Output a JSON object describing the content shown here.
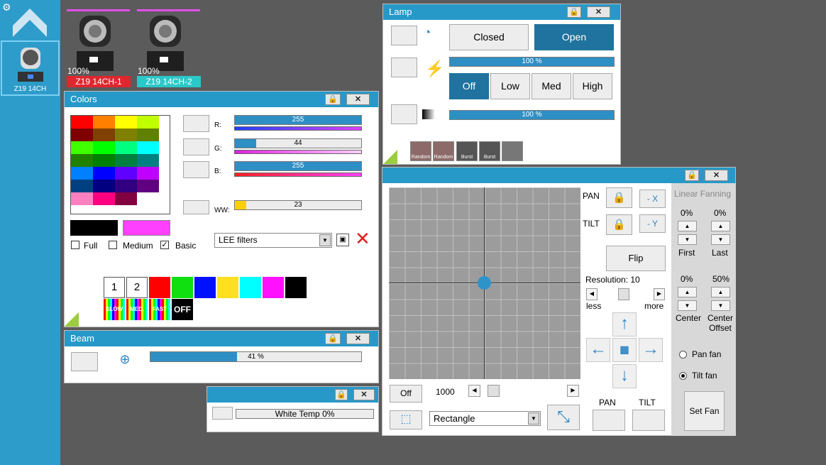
{
  "sidebar": {
    "settings_icon": "gear-icon",
    "logo_icon": "chevron-up-icon",
    "fixture_label": "Z19 14CH"
  },
  "fixtures": [
    {
      "percent": "100%",
      "name": "Z19 14CH-1",
      "color": "#e0262e",
      "bar": "#e050e8"
    },
    {
      "percent": "100%",
      "name": "Z19 14CH-2",
      "color": "#2bc8c8",
      "bar": "#e050e8"
    }
  ],
  "colors": {
    "title": "Colors",
    "lock": "lock-icon",
    "close": "✕",
    "grid": [
      [
        "#ff0000",
        "#ff8000",
        "#ffff00",
        "#c0ff00"
      ],
      [
        "#800000",
        "#804000",
        "#808000",
        "#608000"
      ],
      [
        "#40ff00",
        "#00ff00",
        "#00ff80",
        "#00ffff"
      ],
      [
        "#208000",
        "#008000",
        "#008040",
        "#008080"
      ],
      [
        "#0080ff",
        "#0000ff",
        "#6000ff",
        "#c000ff"
      ],
      [
        "#004080",
        "#000080",
        "#300080",
        "#600080"
      ],
      [
        "#ff80c0",
        "#ff0080",
        "#800040",
        "#ffffff"
      ]
    ],
    "channels": [
      {
        "label": "R:",
        "value": "255",
        "fill": 1.0,
        "grad": "linear-gradient(90deg,#2040ff,#e040ff)"
      },
      {
        "label": "G:",
        "value": "44",
        "fill": 0.17,
        "grad": "linear-gradient(90deg,#e020e0,#ffd0ff)"
      },
      {
        "label": "B:",
        "value": "255",
        "fill": 1.0,
        "grad": "linear-gradient(90deg,#ff2020,#ff40ff)"
      },
      {
        "label": "WW:",
        "value": "23",
        "fill": 0.09
      }
    ],
    "current_color": "#000000",
    "target_color": "#ff40ff",
    "checkboxes": [
      {
        "label": "Full",
        "checked": ""
      },
      {
        "label": "Medium",
        "checked": ""
      },
      {
        "label": "Basic",
        "checked": "✓"
      }
    ],
    "filter_select": "LEE filters",
    "quick": [
      "1",
      "2"
    ],
    "quick_colors": [
      "#ff0000",
      "#10e010",
      "#0010ff",
      "#ffe020",
      "#00ffff",
      "#ff10ff",
      "#000000"
    ],
    "effects": [
      "SLOW",
      "MED.",
      "FAST",
      "OFF"
    ]
  },
  "lamp": {
    "title": "Lamp",
    "closed": "Closed",
    "open": "Open",
    "power_value": "100 %",
    "modes": [
      "Off",
      "Low",
      "Med",
      "High"
    ],
    "dimmer_value": "100 %",
    "fx": [
      "Random",
      "Random",
      "Burst",
      "Burst",
      ""
    ]
  },
  "beam": {
    "title": "Beam",
    "value": "41 %",
    "fill": 0.41
  },
  "white": {
    "title": "",
    "value": "White Temp    0%"
  },
  "pantilt": {
    "pan": "PAN",
    "tilt": "TILT",
    "neg_x": "- X",
    "neg_y": "- Y",
    "flip": "Flip",
    "resolution": "Resolution: 10",
    "less": "less",
    "more": "more",
    "off": "Off",
    "speed": "1000",
    "shape": "Rectangle",
    "pan_btn": "PAN",
    "tilt_btn": "TILT",
    "fanning": {
      "title": "Linear Fanning",
      "first_pct": "0%",
      "last_pct": "0%",
      "first": "First",
      "last": "Last",
      "center_pct": "0%",
      "offset_pct": "50%",
      "center": "Center",
      "center_offset": "Center Offset",
      "pan_fan": "Pan fan",
      "tilt_fan": "Tilt fan",
      "set_fan": "Set Fan"
    }
  }
}
